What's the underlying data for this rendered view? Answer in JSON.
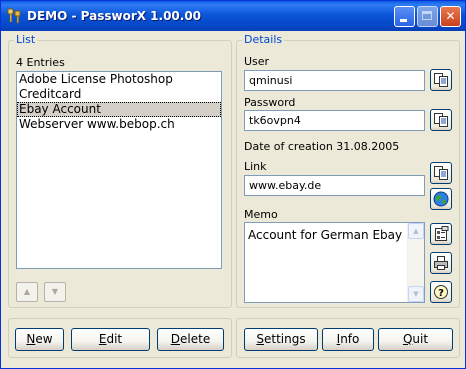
{
  "window": {
    "title": "DEMO - PassworX 1.00.00",
    "min_label": "minimize",
    "max_label": "maximize",
    "close_glyph": "✕"
  },
  "list": {
    "group_title": "List",
    "count_text": "4 Entries",
    "entries": [
      {
        "label": "Adobe License Photoshop",
        "selected": false
      },
      {
        "label": "Creditcard",
        "selected": false
      },
      {
        "label": "Ebay Account",
        "selected": true
      },
      {
        "label": "Webserver www.bebop.ch",
        "selected": false
      }
    ],
    "move_up_glyph": "▲",
    "move_down_glyph": "▼"
  },
  "details": {
    "group_title": "Details",
    "user_label": "User",
    "user_value": "qminusi",
    "password_label": "Password",
    "password_value": "tk6ovpn4",
    "creation_text": "Date of creation 31.08.2005",
    "link_label": "Link",
    "link_value": "www.ebay.de",
    "memo_label": "Memo",
    "memo_value": "Account for German Ebay"
  },
  "buttons": {
    "new": {
      "underline": "N",
      "rest": "ew"
    },
    "edit": {
      "underline": "E",
      "rest": "dit"
    },
    "delete": {
      "underline": "D",
      "rest": "elete"
    },
    "settings": {
      "underline": "S",
      "rest": "ettings"
    },
    "info": {
      "underline": "I",
      "rest": "nfo"
    },
    "quit": {
      "underline": "Q",
      "rest": "uit"
    }
  },
  "icons": {
    "copy_user": "copy-icon",
    "copy_password": "copy-icon",
    "copy_link": "copy-icon",
    "open_link": "globe-icon",
    "properties": "properties-icon",
    "print": "printer-icon",
    "help": "help-icon"
  },
  "colors": {
    "titlebar": "#0a5ce0",
    "group_title": "#0046d5",
    "selection": "#d4d0c8",
    "window_bg": "#ece9d8"
  }
}
